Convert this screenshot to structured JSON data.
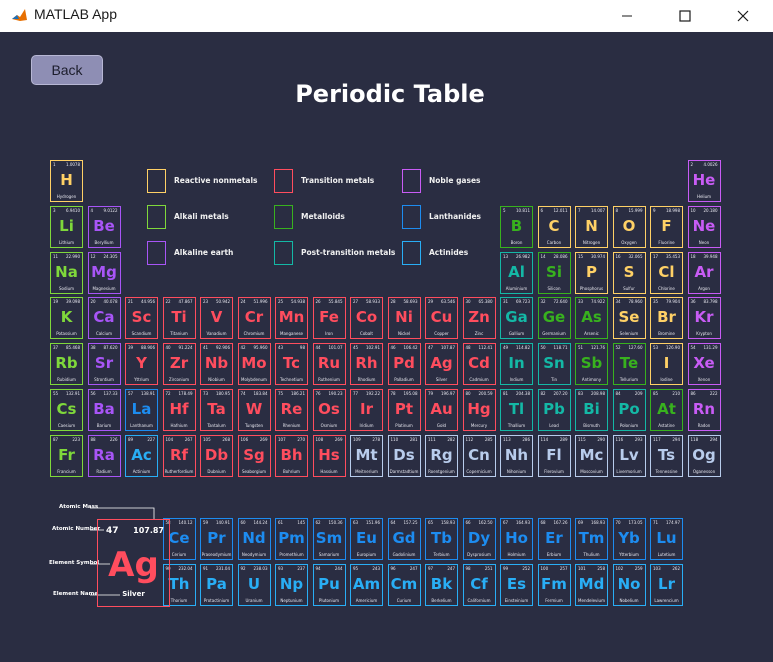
{
  "window": {
    "title": "MATLAB App"
  },
  "back_label": "Back",
  "page_title": "Periodic Table",
  "colors": {
    "reactive": "#ffd166",
    "alkali": "#7fd83b",
    "alkaline": "#a855f7",
    "transition": "#ff4d5e",
    "metalloid": "#38b21e",
    "post": "#14b8a6",
    "noble": "#c85cf5",
    "lanthanide": "#1d8cf0",
    "actinide": "#29aef5",
    "unknown": "#b8ccec"
  },
  "legend": [
    {
      "label": "Reactive nonmetals",
      "cat": "reactive"
    },
    {
      "label": "Alkali metals",
      "cat": "alkali"
    },
    {
      "label": "Alkaline earth",
      "cat": "alkaline"
    },
    {
      "label": "Transition metals",
      "cat": "transition"
    },
    {
      "label": "Metalloids",
      "cat": "metalloid"
    },
    {
      "label": "Post-transition metals",
      "cat": "post"
    },
    {
      "label": "Noble gases",
      "cat": "noble"
    },
    {
      "label": "Lanthanides",
      "cat": "lanthanide"
    },
    {
      "label": "Actinides",
      "cat": "actinide"
    }
  ],
  "key": {
    "number": "47",
    "mass": "107.87",
    "symbol": "Ag",
    "name": "Silver",
    "labels": {
      "mass": "Atomic Mass",
      "number": "Atomic Number",
      "symbol": "Element Symbol",
      "name": "Element Name"
    }
  },
  "elements": [
    {
      "n": 1,
      "s": "H",
      "name": "Hydrogen",
      "m": "1.0078",
      "row": 1,
      "col": 1,
      "cat": "reactive"
    },
    {
      "n": 2,
      "s": "He",
      "name": "Helium",
      "m": "4.0026",
      "row": 1,
      "col": 18,
      "cat": "noble"
    },
    {
      "n": 3,
      "s": "Li",
      "name": "Lithium",
      "m": "6.9410",
      "row": 2,
      "col": 1,
      "cat": "alkali"
    },
    {
      "n": 4,
      "s": "Be",
      "name": "Beryllium",
      "m": "9.0122",
      "row": 2,
      "col": 2,
      "cat": "alkaline"
    },
    {
      "n": 5,
      "s": "B",
      "name": "Boron",
      "m": "10.811",
      "row": 2,
      "col": 13,
      "cat": "metalloid"
    },
    {
      "n": 6,
      "s": "C",
      "name": "Carbon",
      "m": "12.011",
      "row": 2,
      "col": 14,
      "cat": "reactive"
    },
    {
      "n": 7,
      "s": "N",
      "name": "Nitrogen",
      "m": "14.007",
      "row": 2,
      "col": 15,
      "cat": "reactive"
    },
    {
      "n": 8,
      "s": "O",
      "name": "Oxygen",
      "m": "15.999",
      "row": 2,
      "col": 16,
      "cat": "reactive"
    },
    {
      "n": 9,
      "s": "F",
      "name": "Fluorine",
      "m": "18.998",
      "row": 2,
      "col": 17,
      "cat": "reactive"
    },
    {
      "n": 10,
      "s": "Ne",
      "name": "Neon",
      "m": "20.180",
      "row": 2,
      "col": 18,
      "cat": "noble"
    },
    {
      "n": 11,
      "s": "Na",
      "name": "Sodium",
      "m": "22.990",
      "row": 3,
      "col": 1,
      "cat": "alkali"
    },
    {
      "n": 12,
      "s": "Mg",
      "name": "Magnesium",
      "m": "24.305",
      "row": 3,
      "col": 2,
      "cat": "alkaline"
    },
    {
      "n": 13,
      "s": "Al",
      "name": "Aluminium",
      "m": "26.982",
      "row": 3,
      "col": 13,
      "cat": "post"
    },
    {
      "n": 14,
      "s": "Si",
      "name": "Silicon",
      "m": "28.086",
      "row": 3,
      "col": 14,
      "cat": "metalloid"
    },
    {
      "n": 15,
      "s": "P",
      "name": "Phosphorus",
      "m": "30.974",
      "row": 3,
      "col": 15,
      "cat": "reactive"
    },
    {
      "n": 16,
      "s": "S",
      "name": "Sulfur",
      "m": "32.065",
      "row": 3,
      "col": 16,
      "cat": "reactive"
    },
    {
      "n": 17,
      "s": "Cl",
      "name": "Chlorine",
      "m": "35.453",
      "row": 3,
      "col": 17,
      "cat": "reactive"
    },
    {
      "n": 18,
      "s": "Ar",
      "name": "Argon",
      "m": "39.948",
      "row": 3,
      "col": 18,
      "cat": "noble"
    },
    {
      "n": 19,
      "s": "K",
      "name": "Potassium",
      "m": "39.098",
      "row": 4,
      "col": 1,
      "cat": "alkali"
    },
    {
      "n": 20,
      "s": "Ca",
      "name": "Calcium",
      "m": "40.078",
      "row": 4,
      "col": 2,
      "cat": "alkaline"
    },
    {
      "n": 21,
      "s": "Sc",
      "name": "Scandium",
      "m": "44.956",
      "row": 4,
      "col": 3,
      "cat": "transition"
    },
    {
      "n": 22,
      "s": "Ti",
      "name": "Titanium",
      "m": "47.867",
      "row": 4,
      "col": 4,
      "cat": "transition"
    },
    {
      "n": 23,
      "s": "V",
      "name": "Vanadium",
      "m": "50.942",
      "row": 4,
      "col": 5,
      "cat": "transition"
    },
    {
      "n": 24,
      "s": "Cr",
      "name": "Chromium",
      "m": "51.996",
      "row": 4,
      "col": 6,
      "cat": "transition"
    },
    {
      "n": 25,
      "s": "Mn",
      "name": "Manganese",
      "m": "54.938",
      "row": 4,
      "col": 7,
      "cat": "transition"
    },
    {
      "n": 26,
      "s": "Fe",
      "name": "Iron",
      "m": "55.845",
      "row": 4,
      "col": 8,
      "cat": "transition"
    },
    {
      "n": 27,
      "s": "Co",
      "name": "Cobalt",
      "m": "58.933",
      "row": 4,
      "col": 9,
      "cat": "transition"
    },
    {
      "n": 28,
      "s": "Ni",
      "name": "Nickel",
      "m": "58.693",
      "row": 4,
      "col": 10,
      "cat": "transition"
    },
    {
      "n": 29,
      "s": "Cu",
      "name": "Copper",
      "m": "63.546",
      "row": 4,
      "col": 11,
      "cat": "transition"
    },
    {
      "n": 30,
      "s": "Zn",
      "name": "Zinc",
      "m": "65.380",
      "row": 4,
      "col": 12,
      "cat": "transition"
    },
    {
      "n": 31,
      "s": "Ga",
      "name": "Gallium",
      "m": "69.723",
      "row": 4,
      "col": 13,
      "cat": "post"
    },
    {
      "n": 32,
      "s": "Ge",
      "name": "Germanium",
      "m": "72.640",
      "row": 4,
      "col": 14,
      "cat": "metalloid"
    },
    {
      "n": 33,
      "s": "As",
      "name": "Arsenic",
      "m": "74.922",
      "row": 4,
      "col": 15,
      "cat": "metalloid"
    },
    {
      "n": 34,
      "s": "Se",
      "name": "Selenium",
      "m": "78.960",
      "row": 4,
      "col": 16,
      "cat": "reactive"
    },
    {
      "n": 35,
      "s": "Br",
      "name": "Bromine",
      "m": "79.904",
      "row": 4,
      "col": 17,
      "cat": "reactive"
    },
    {
      "n": 36,
      "s": "Kr",
      "name": "Krypton",
      "m": "83.798",
      "row": 4,
      "col": 18,
      "cat": "noble"
    },
    {
      "n": 37,
      "s": "Rb",
      "name": "Rubidium",
      "m": "85.468",
      "row": 5,
      "col": 1,
      "cat": "alkali"
    },
    {
      "n": 38,
      "s": "Sr",
      "name": "Strontium",
      "m": "87.620",
      "row": 5,
      "col": 2,
      "cat": "alkaline"
    },
    {
      "n": 39,
      "s": "Y",
      "name": "Yttrium",
      "m": "88.906",
      "row": 5,
      "col": 3,
      "cat": "transition"
    },
    {
      "n": 40,
      "s": "Zr",
      "name": "Zirconium",
      "m": "91.224",
      "row": 5,
      "col": 4,
      "cat": "transition"
    },
    {
      "n": 41,
      "s": "Nb",
      "name": "Niobium",
      "m": "92.906",
      "row": 5,
      "col": 5,
      "cat": "transition"
    },
    {
      "n": 42,
      "s": "Mo",
      "name": "Molybdenum",
      "m": "95.960",
      "row": 5,
      "col": 6,
      "cat": "transition"
    },
    {
      "n": 43,
      "s": "Tc",
      "name": "Technetium",
      "m": "98",
      "row": 5,
      "col": 7,
      "cat": "transition"
    },
    {
      "n": 44,
      "s": "Ru",
      "name": "Ruthenium",
      "m": "101.07",
      "row": 5,
      "col": 8,
      "cat": "transition"
    },
    {
      "n": 45,
      "s": "Rh",
      "name": "Rhodium",
      "m": "102.91",
      "row": 5,
      "col": 9,
      "cat": "transition"
    },
    {
      "n": 46,
      "s": "Pd",
      "name": "Palladium",
      "m": "106.42",
      "row": 5,
      "col": 10,
      "cat": "transition"
    },
    {
      "n": 47,
      "s": "Ag",
      "name": "Silver",
      "m": "107.87",
      "row": 5,
      "col": 11,
      "cat": "transition"
    },
    {
      "n": 48,
      "s": "Cd",
      "name": "Cadmium",
      "m": "112.41",
      "row": 5,
      "col": 12,
      "cat": "transition"
    },
    {
      "n": 49,
      "s": "In",
      "name": "Indium",
      "m": "114.82",
      "row": 5,
      "col": 13,
      "cat": "post"
    },
    {
      "n": 50,
      "s": "Sn",
      "name": "Tin",
      "m": "118.71",
      "row": 5,
      "col": 14,
      "cat": "post"
    },
    {
      "n": 51,
      "s": "Sb",
      "name": "Antimony",
      "m": "121.76",
      "row": 5,
      "col": 15,
      "cat": "metalloid"
    },
    {
      "n": 52,
      "s": "Te",
      "name": "Tellurium",
      "m": "127.60",
      "row": 5,
      "col": 16,
      "cat": "metalloid"
    },
    {
      "n": 53,
      "s": "I",
      "name": "Iodine",
      "m": "126.90",
      "row": 5,
      "col": 17,
      "cat": "reactive"
    },
    {
      "n": 54,
      "s": "Xe",
      "name": "Xenon",
      "m": "131.29",
      "row": 5,
      "col": 18,
      "cat": "noble"
    },
    {
      "n": 55,
      "s": "Cs",
      "name": "Caesium",
      "m": "132.91",
      "row": 6,
      "col": 1,
      "cat": "alkali"
    },
    {
      "n": 56,
      "s": "Ba",
      "name": "Barium",
      "m": "137.33",
      "row": 6,
      "col": 2,
      "cat": "alkaline"
    },
    {
      "n": 57,
      "s": "La",
      "name": "Lanthanum",
      "m": "138.91",
      "row": 6,
      "col": 3,
      "cat": "lanthanide"
    },
    {
      "n": 72,
      "s": "Hf",
      "name": "Hafnium",
      "m": "178.49",
      "row": 6,
      "col": 4,
      "cat": "transition"
    },
    {
      "n": 73,
      "s": "Ta",
      "name": "Tantalum",
      "m": "180.95",
      "row": 6,
      "col": 5,
      "cat": "transition"
    },
    {
      "n": 74,
      "s": "W",
      "name": "Tungsten",
      "m": "183.84",
      "row": 6,
      "col": 6,
      "cat": "transition"
    },
    {
      "n": 75,
      "s": "Re",
      "name": "Rhenium",
      "m": "186.21",
      "row": 6,
      "col": 7,
      "cat": "transition"
    },
    {
      "n": 76,
      "s": "Os",
      "name": "Osmium",
      "m": "190.23",
      "row": 6,
      "col": 8,
      "cat": "transition"
    },
    {
      "n": 77,
      "s": "Ir",
      "name": "Iridium",
      "m": "192.22",
      "row": 6,
      "col": 9,
      "cat": "transition"
    },
    {
      "n": 78,
      "s": "Pt",
      "name": "Platinum",
      "m": "195.08",
      "row": 6,
      "col": 10,
      "cat": "transition"
    },
    {
      "n": 79,
      "s": "Au",
      "name": "Gold",
      "m": "196.97",
      "row": 6,
      "col": 11,
      "cat": "transition"
    },
    {
      "n": 80,
      "s": "Hg",
      "name": "Mercury",
      "m": "200.59",
      "row": 6,
      "col": 12,
      "cat": "transition"
    },
    {
      "n": 81,
      "s": "Tl",
      "name": "Thallium",
      "m": "204.38",
      "row": 6,
      "col": 13,
      "cat": "post"
    },
    {
      "n": 82,
      "s": "Pb",
      "name": "Lead",
      "m": "207.20",
      "row": 6,
      "col": 14,
      "cat": "post"
    },
    {
      "n": 83,
      "s": "Bi",
      "name": "Bismuth",
      "m": "208.98",
      "row": 6,
      "col": 15,
      "cat": "post"
    },
    {
      "n": 84,
      "s": "Po",
      "name": "Polonium",
      "m": "209",
      "row": 6,
      "col": 16,
      "cat": "post"
    },
    {
      "n": 85,
      "s": "At",
      "name": "Astatine",
      "m": "210",
      "row": 6,
      "col": 17,
      "cat": "metalloid"
    },
    {
      "n": 86,
      "s": "Rn",
      "name": "Radon",
      "m": "222",
      "row": 6,
      "col": 18,
      "cat": "noble"
    },
    {
      "n": 87,
      "s": "Fr",
      "name": "Francium",
      "m": "223",
      "row": 7,
      "col": 1,
      "cat": "alkali"
    },
    {
      "n": 88,
      "s": "Ra",
      "name": "Radium",
      "m": "226",
      "row": 7,
      "col": 2,
      "cat": "alkaline"
    },
    {
      "n": 89,
      "s": "Ac",
      "name": "Actinium",
      "m": "227",
      "row": 7,
      "col": 3,
      "cat": "actinide"
    },
    {
      "n": 104,
      "s": "Rf",
      "name": "Rutherfordium",
      "m": "267",
      "row": 7,
      "col": 4,
      "cat": "transition"
    },
    {
      "n": 105,
      "s": "Db",
      "name": "Dubnium",
      "m": "268",
      "row": 7,
      "col": 5,
      "cat": "transition"
    },
    {
      "n": 106,
      "s": "Sg",
      "name": "Seaborgium",
      "m": "269",
      "row": 7,
      "col": 6,
      "cat": "transition"
    },
    {
      "n": 107,
      "s": "Bh",
      "name": "Bohrium",
      "m": "270",
      "row": 7,
      "col": 7,
      "cat": "transition"
    },
    {
      "n": 108,
      "s": "Hs",
      "name": "Hassium",
      "m": "269",
      "row": 7,
      "col": 8,
      "cat": "transition"
    },
    {
      "n": 109,
      "s": "Mt",
      "name": "Meitnerium",
      "m": "278",
      "row": 7,
      "col": 9,
      "cat": "unknown"
    },
    {
      "n": 110,
      "s": "Ds",
      "name": "Darmstadtium",
      "m": "281",
      "row": 7,
      "col": 10,
      "cat": "unknown"
    },
    {
      "n": 111,
      "s": "Rg",
      "name": "Roentgenium",
      "m": "282",
      "row": 7,
      "col": 11,
      "cat": "unknown"
    },
    {
      "n": 112,
      "s": "Cn",
      "name": "Copernicium",
      "m": "285",
      "row": 7,
      "col": 12,
      "cat": "unknown"
    },
    {
      "n": 113,
      "s": "Nh",
      "name": "Nihonium",
      "m": "286",
      "row": 7,
      "col": 13,
      "cat": "unknown"
    },
    {
      "n": 114,
      "s": "Fl",
      "name": "Flerovium",
      "m": "289",
      "row": 7,
      "col": 14,
      "cat": "unknown"
    },
    {
      "n": 115,
      "s": "Mc",
      "name": "Moscovium",
      "m": "290",
      "row": 7,
      "col": 15,
      "cat": "unknown"
    },
    {
      "n": 116,
      "s": "Lv",
      "name": "Livermorium",
      "m": "293",
      "row": 7,
      "col": 16,
      "cat": "unknown"
    },
    {
      "n": 117,
      "s": "Ts",
      "name": "Tennessine",
      "m": "294",
      "row": 7,
      "col": 17,
      "cat": "unknown"
    },
    {
      "n": 118,
      "s": "Og",
      "name": "Oganesson",
      "m": "294",
      "row": 7,
      "col": 18,
      "cat": "unknown"
    },
    {
      "n": 58,
      "s": "Ce",
      "name": "Cerium",
      "m": "140.12",
      "row": 9,
      "col": 4,
      "cat": "lanthanide"
    },
    {
      "n": 59,
      "s": "Pr",
      "name": "Praseodymium",
      "m": "140.91",
      "row": 9,
      "col": 5,
      "cat": "lanthanide"
    },
    {
      "n": 60,
      "s": "Nd",
      "name": "Neodymium",
      "m": "144.24",
      "row": 9,
      "col": 6,
      "cat": "lanthanide"
    },
    {
      "n": 61,
      "s": "Pm",
      "name": "Promethium",
      "m": "145",
      "row": 9,
      "col": 7,
      "cat": "lanthanide"
    },
    {
      "n": 62,
      "s": "Sm",
      "name": "Samarium",
      "m": "150.36",
      "row": 9,
      "col": 8,
      "cat": "lanthanide"
    },
    {
      "n": 63,
      "s": "Eu",
      "name": "Europium",
      "m": "151.96",
      "row": 9,
      "col": 9,
      "cat": "lanthanide"
    },
    {
      "n": 64,
      "s": "Gd",
      "name": "Gadolinium",
      "m": "157.25",
      "row": 9,
      "col": 10,
      "cat": "lanthanide"
    },
    {
      "n": 65,
      "s": "Tb",
      "name": "Terbium",
      "m": "158.93",
      "row": 9,
      "col": 11,
      "cat": "lanthanide"
    },
    {
      "n": 66,
      "s": "Dy",
      "name": "Dysprosium",
      "m": "162.50",
      "row": 9,
      "col": 12,
      "cat": "lanthanide"
    },
    {
      "n": 67,
      "s": "Ho",
      "name": "Holmium",
      "m": "164.93",
      "row": 9,
      "col": 13,
      "cat": "lanthanide"
    },
    {
      "n": 68,
      "s": "Er",
      "name": "Erbium",
      "m": "167.26",
      "row": 9,
      "col": 14,
      "cat": "lanthanide"
    },
    {
      "n": 69,
      "s": "Tm",
      "name": "Thulium",
      "m": "168.93",
      "row": 9,
      "col": 15,
      "cat": "lanthanide"
    },
    {
      "n": 70,
      "s": "Yb",
      "name": "Ytterbium",
      "m": "173.05",
      "row": 9,
      "col": 16,
      "cat": "lanthanide"
    },
    {
      "n": 71,
      "s": "Lu",
      "name": "Lutetium",
      "m": "174.97",
      "row": 9,
      "col": 17,
      "cat": "lanthanide"
    },
    {
      "n": 90,
      "s": "Th",
      "name": "Thorium",
      "m": "232.04",
      "row": 10,
      "col": 4,
      "cat": "actinide"
    },
    {
      "n": 91,
      "s": "Pa",
      "name": "Protactinium",
      "m": "231.04",
      "row": 10,
      "col": 5,
      "cat": "actinide"
    },
    {
      "n": 92,
      "s": "U",
      "name": "Uranium",
      "m": "238.03",
      "row": 10,
      "col": 6,
      "cat": "actinide"
    },
    {
      "n": 93,
      "s": "Np",
      "name": "Neptunium",
      "m": "237",
      "row": 10,
      "col": 7,
      "cat": "actinide"
    },
    {
      "n": 94,
      "s": "Pu",
      "name": "Plutonium",
      "m": "244",
      "row": 10,
      "col": 8,
      "cat": "actinide"
    },
    {
      "n": 95,
      "s": "Am",
      "name": "Americium",
      "m": "243",
      "row": 10,
      "col": 9,
      "cat": "actinide"
    },
    {
      "n": 96,
      "s": "Cm",
      "name": "Curium",
      "m": "247",
      "row": 10,
      "col": 10,
      "cat": "actinide"
    },
    {
      "n": 97,
      "s": "Bk",
      "name": "Berkelium",
      "m": "247",
      "row": 10,
      "col": 11,
      "cat": "actinide"
    },
    {
      "n": 98,
      "s": "Cf",
      "name": "Californium",
      "m": "251",
      "row": 10,
      "col": 12,
      "cat": "actinide"
    },
    {
      "n": 99,
      "s": "Es",
      "name": "Einsteinium",
      "m": "252",
      "row": 10,
      "col": 13,
      "cat": "actinide"
    },
    {
      "n": 100,
      "s": "Fm",
      "name": "Fermium",
      "m": "257",
      "row": 10,
      "col": 14,
      "cat": "actinide"
    },
    {
      "n": 101,
      "s": "Md",
      "name": "Mendelevium",
      "m": "258",
      "row": 10,
      "col": 15,
      "cat": "actinide"
    },
    {
      "n": 102,
      "s": "No",
      "name": "Nobelium",
      "m": "259",
      "row": 10,
      "col": 16,
      "cat": "actinide"
    },
    {
      "n": 103,
      "s": "Lr",
      "name": "Lawrencium",
      "m": "262",
      "row": 10,
      "col": 17,
      "cat": "actinide"
    }
  ]
}
